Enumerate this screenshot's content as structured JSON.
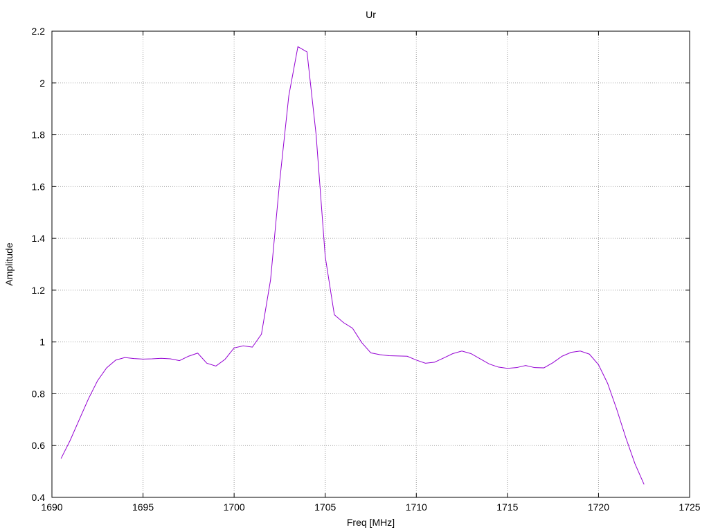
{
  "chart_data": {
    "type": "line",
    "title": "Ur",
    "xlabel": "Freq [MHz]",
    "ylabel": "Amplitude",
    "xlim": [
      1690,
      1725
    ],
    "ylim": [
      0.4,
      2.2
    ],
    "xticks": [
      1690,
      1695,
      1700,
      1705,
      1710,
      1715,
      1720,
      1725
    ],
    "yticks": [
      0.4,
      0.6,
      0.8,
      1,
      1.2,
      1.4,
      1.6,
      1.8,
      2,
      2.2
    ],
    "xtick_labels": [
      "1690",
      "1695",
      "1700",
      "1705",
      "1710",
      "1715",
      "1720",
      "1725"
    ],
    "ytick_labels": [
      "0.4",
      "0.6",
      "0.8",
      "1",
      "1.2",
      "1.4",
      "1.6",
      "1.8",
      "2",
      "2.2"
    ],
    "grid": true,
    "line_color": "#9400d3",
    "series": [
      {
        "x": [
          1690.5,
          1691.0,
          1691.5,
          1692.0,
          1692.5,
          1693.0,
          1693.5,
          1694.0,
          1694.5,
          1695.0,
          1695.5,
          1696.0,
          1696.5,
          1697.0,
          1697.5,
          1698.0,
          1698.5,
          1699.0,
          1699.5,
          1700.0,
          1700.5,
          1701.0,
          1701.5,
          1702.0,
          1702.5,
          1703.0,
          1703.5,
          1704.0,
          1704.5,
          1705.0,
          1705.5,
          1706.0,
          1706.5,
          1707.0,
          1707.5,
          1708.0,
          1708.5,
          1709.0,
          1709.5,
          1710.0,
          1710.5,
          1711.0,
          1711.5,
          1712.0,
          1712.5,
          1713.0,
          1713.5,
          1714.0,
          1714.5,
          1715.0,
          1715.5,
          1716.0,
          1716.5,
          1717.0,
          1717.5,
          1718.0,
          1718.5,
          1719.0,
          1719.5,
          1720.0,
          1720.5,
          1721.0,
          1721.5,
          1722.0,
          1722.5
        ],
        "y": [
          0.55,
          0.62,
          0.7,
          0.78,
          0.85,
          0.9,
          0.93,
          0.94,
          0.936,
          0.934,
          0.935,
          0.937,
          0.935,
          0.928,
          0.945,
          0.957,
          0.918,
          0.907,
          0.933,
          0.977,
          0.985,
          0.98,
          1.03,
          1.24,
          1.62,
          1.95,
          2.14,
          2.12,
          1.8,
          1.33,
          1.105,
          1.075,
          1.053,
          0.998,
          0.958,
          0.951,
          0.947,
          0.946,
          0.945,
          0.93,
          0.918,
          0.922,
          0.938,
          0.955,
          0.965,
          0.955,
          0.935,
          0.915,
          0.903,
          0.898,
          0.901,
          0.909,
          0.901,
          0.9,
          0.92,
          0.945,
          0.96,
          0.965,
          0.953,
          0.912,
          0.84,
          0.74,
          0.63,
          0.53,
          0.45
        ]
      }
    ]
  }
}
